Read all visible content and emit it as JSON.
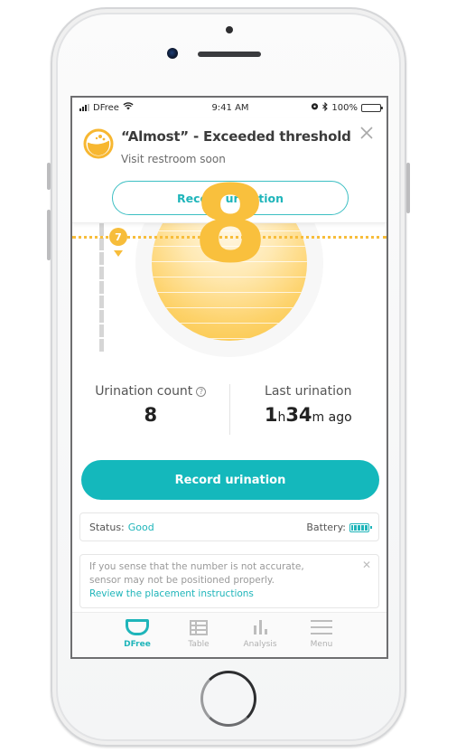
{
  "status_bar": {
    "carrier": "DFree",
    "time": "9:41 AM",
    "battery_percent": "100%",
    "icons": [
      "signal-icon",
      "wifi-icon",
      "alarm-icon",
      "bluetooth-icon",
      "battery-icon"
    ]
  },
  "notification": {
    "title": "“Almost” - Exceeded threshold",
    "subtitle": "Visit restroom soon",
    "button_label": "Record urination",
    "close_symbol": "✕",
    "icon": "bladder-level-icon"
  },
  "gauge": {
    "level_value": "8",
    "threshold_value": "7",
    "accent_color": "#f9c03d"
  },
  "stats": {
    "count_label": "Urination count",
    "count_value": "8",
    "help_symbol": "?",
    "last_label": "Last urination",
    "last_hours": "1",
    "last_hours_unit": "h",
    "last_minutes": "34",
    "last_minutes_unit": "m ago"
  },
  "main_button": {
    "label": "Record urination"
  },
  "device_status": {
    "status_label": "Status:",
    "status_value": "Good",
    "battery_label": "Battery:",
    "battery_level": 1.0
  },
  "info_card": {
    "line1": "If you sense that the number is not accurate,",
    "line2": "sensor may not be positioned properly.",
    "link": "Review the placement instructions",
    "close_symbol": "✕"
  },
  "tabbar": {
    "items": [
      {
        "label": "DFree",
        "icon": "dfree-device-icon",
        "active": true
      },
      {
        "label": "Table",
        "icon": "table-icon",
        "active": false
      },
      {
        "label": "Analysis",
        "icon": "bar-chart-icon",
        "active": false
      },
      {
        "label": "Menu",
        "icon": "hamburger-menu-icon",
        "active": false
      }
    ]
  },
  "colors": {
    "teal": "#14b8bc",
    "yellow": "#f9c03d",
    "text_dark": "#3b3b3b"
  }
}
